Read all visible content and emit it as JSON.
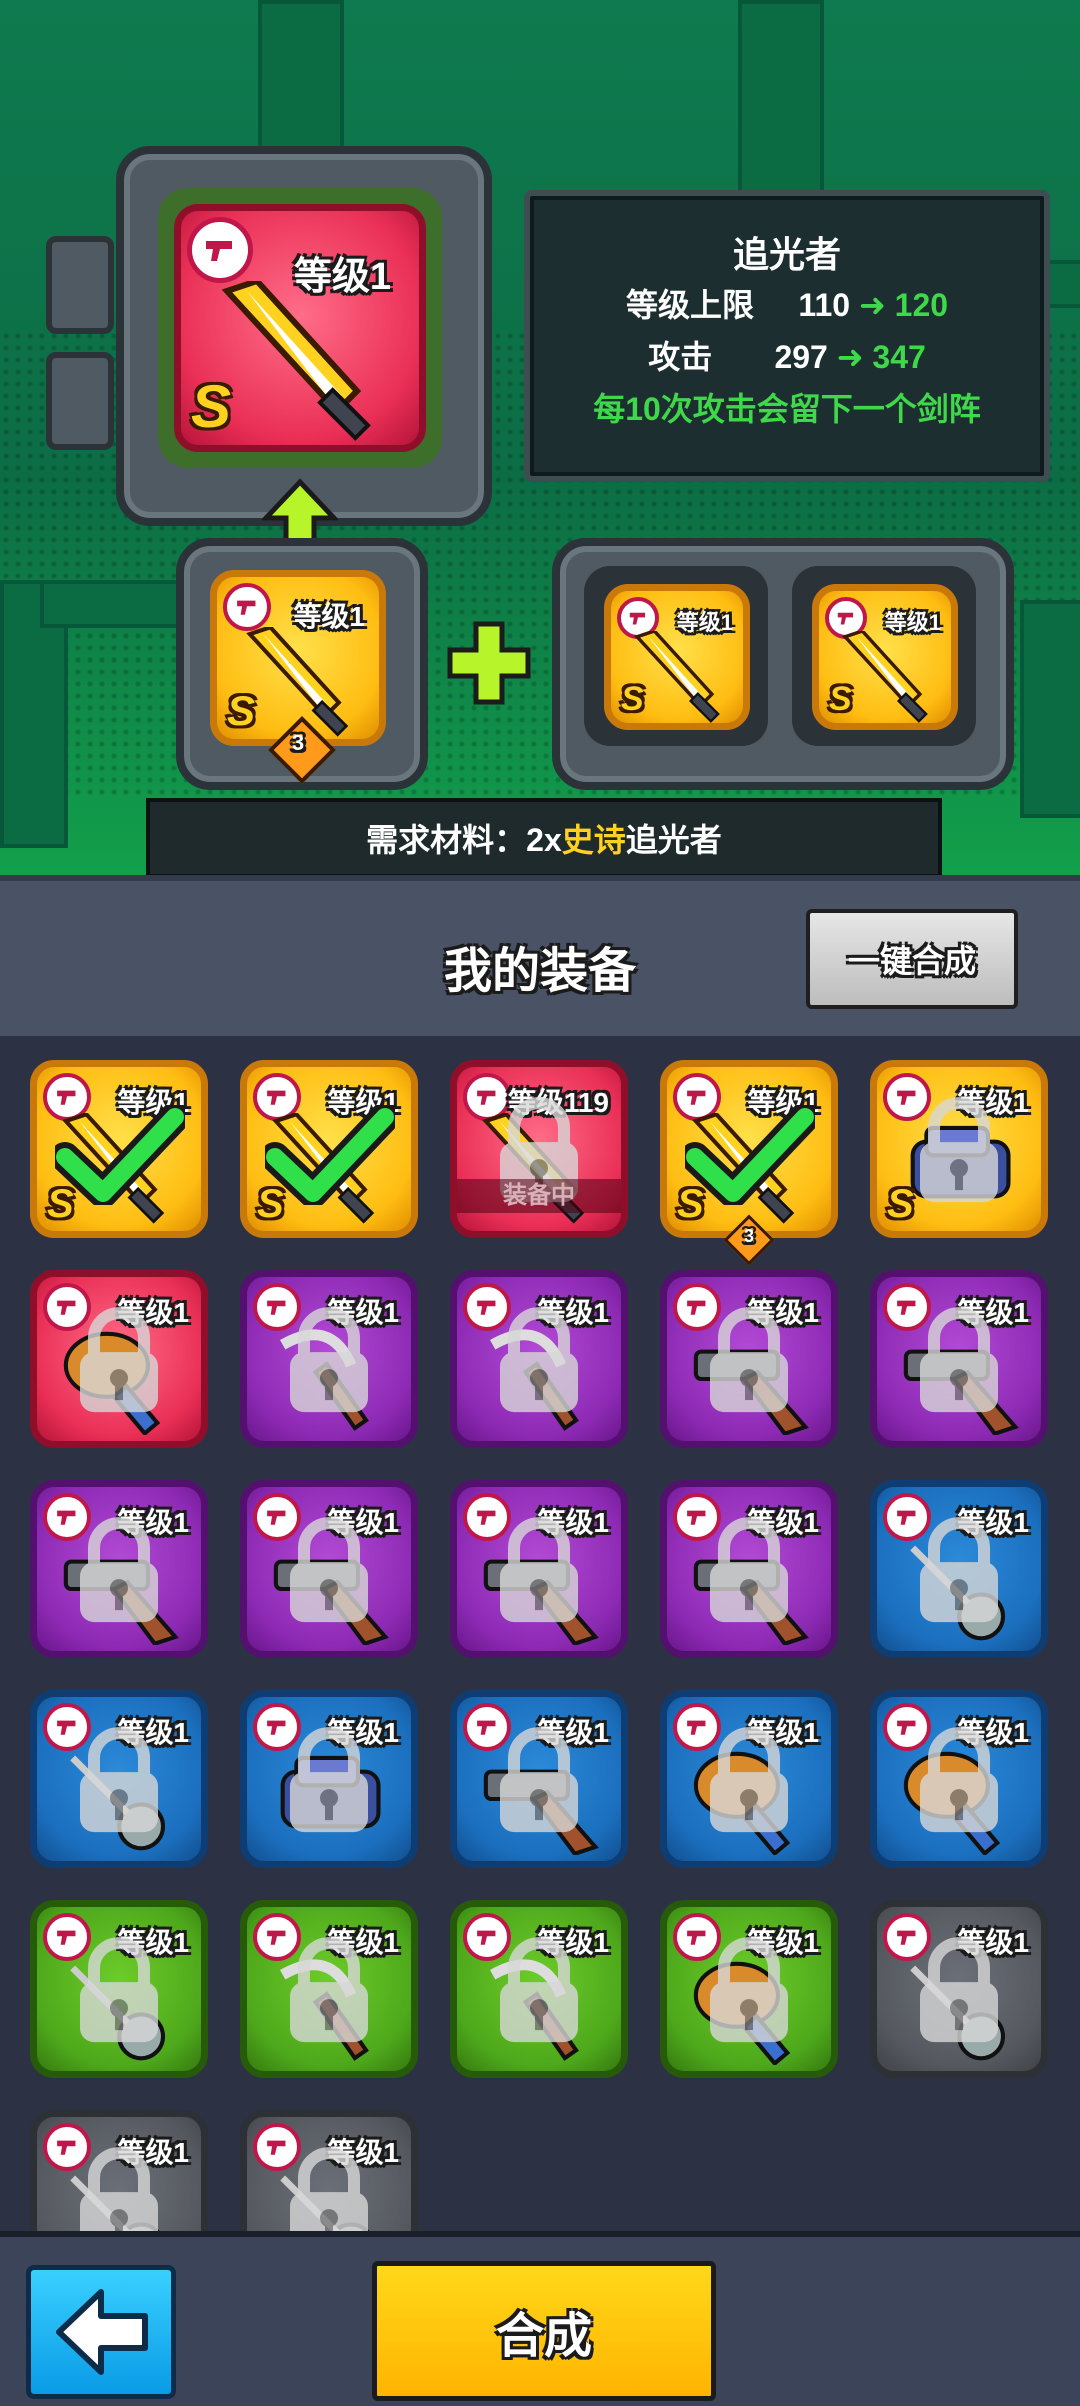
{
  "preview": {
    "result_level": "等级1",
    "result_rank": "S",
    "source_level": "等级1",
    "source_rank": "S",
    "source_count": "3",
    "mat1_level": "等级1",
    "mat1_rank": "S",
    "mat2_level": "等级1",
    "mat2_rank": "S"
  },
  "info": {
    "name": "追光者",
    "cap_label": "等级上限",
    "cap_from": "110",
    "cap_to": "120",
    "atk_label": "攻击",
    "atk_from": "297",
    "atk_to": "347",
    "effect": "每10次攻击会留下一个剑阵"
  },
  "requirement": {
    "prefix": "需求材料：2x",
    "rarity": "史诗",
    "item": "追光者"
  },
  "header": {
    "title": "我的装备",
    "one_key_label": "一键合成"
  },
  "equipment_rows": [
    [
      {
        "level": "等级1",
        "rarity": "yellow",
        "rank": "S",
        "state": "checked",
        "weapon": "sword"
      },
      {
        "level": "等级1",
        "rarity": "yellow",
        "rank": "S",
        "state": "checked",
        "weapon": "sword"
      },
      {
        "level": "等级119",
        "rarity": "red",
        "rank": "",
        "state": "equipped",
        "weapon": "sword",
        "note": "装备中"
      },
      {
        "level": "等级1",
        "rarity": "yellow",
        "rank": "S",
        "state": "checked",
        "weapon": "sword",
        "count": "3"
      },
      {
        "level": "等级1",
        "rarity": "yellow",
        "rank": "S",
        "state": "locked",
        "weapon": "gauntlet"
      }
    ],
    [
      {
        "level": "等级1",
        "rarity": "red",
        "state": "locked",
        "weapon": "club"
      },
      {
        "level": "等级1",
        "rarity": "purple",
        "state": "locked",
        "weapon": "scythe"
      },
      {
        "level": "等级1",
        "rarity": "purple",
        "state": "locked",
        "weapon": "scythe"
      },
      {
        "level": "等级1",
        "rarity": "purple",
        "state": "locked",
        "weapon": "gun"
      },
      {
        "level": "等级1",
        "rarity": "purple",
        "state": "locked",
        "weapon": "gun"
      }
    ],
    [
      {
        "level": "等级1",
        "rarity": "purple",
        "state": "locked",
        "weapon": "gun"
      },
      {
        "level": "等级1",
        "rarity": "purple",
        "state": "locked",
        "weapon": "gun"
      },
      {
        "level": "等级1",
        "rarity": "purple",
        "state": "locked",
        "weapon": "gun"
      },
      {
        "level": "等级1",
        "rarity": "purple",
        "state": "locked",
        "weapon": "gun"
      },
      {
        "level": "等级1",
        "rarity": "blue",
        "state": "locked",
        "weapon": "flail"
      }
    ],
    [
      {
        "level": "等级1",
        "rarity": "blue",
        "state": "locked",
        "weapon": "flail"
      },
      {
        "level": "等级1",
        "rarity": "blue",
        "state": "locked",
        "weapon": "gauntlet"
      },
      {
        "level": "等级1",
        "rarity": "blue",
        "state": "locked",
        "weapon": "gun"
      },
      {
        "level": "等级1",
        "rarity": "blue",
        "state": "locked",
        "weapon": "club"
      },
      {
        "level": "等级1",
        "rarity": "blue",
        "state": "locked",
        "weapon": "club"
      }
    ],
    [
      {
        "level": "等级1",
        "rarity": "green",
        "state": "locked",
        "weapon": "flail"
      },
      {
        "level": "等级1",
        "rarity": "green",
        "state": "locked",
        "weapon": "scythe"
      },
      {
        "level": "等级1",
        "rarity": "green",
        "state": "locked",
        "weapon": "scythe"
      },
      {
        "level": "等级1",
        "rarity": "green",
        "state": "locked",
        "weapon": "club"
      },
      {
        "level": "等级1",
        "rarity": "gray",
        "state": "locked",
        "weapon": "flail"
      }
    ],
    [
      {
        "level": "等级1",
        "rarity": "gray",
        "state": "locked",
        "weapon": "flail"
      },
      {
        "level": "等级1",
        "rarity": "gray",
        "state": "locked",
        "weapon": "flail"
      }
    ]
  ],
  "footer": {
    "back_icon": "left-arrow-icon",
    "combine_label": "合成"
  },
  "colors": {
    "accent_green": "#3ed84a",
    "accent_yellow": "#ffd21f",
    "combine_button": "#ffc400",
    "back_button": "#1aaaf0"
  }
}
